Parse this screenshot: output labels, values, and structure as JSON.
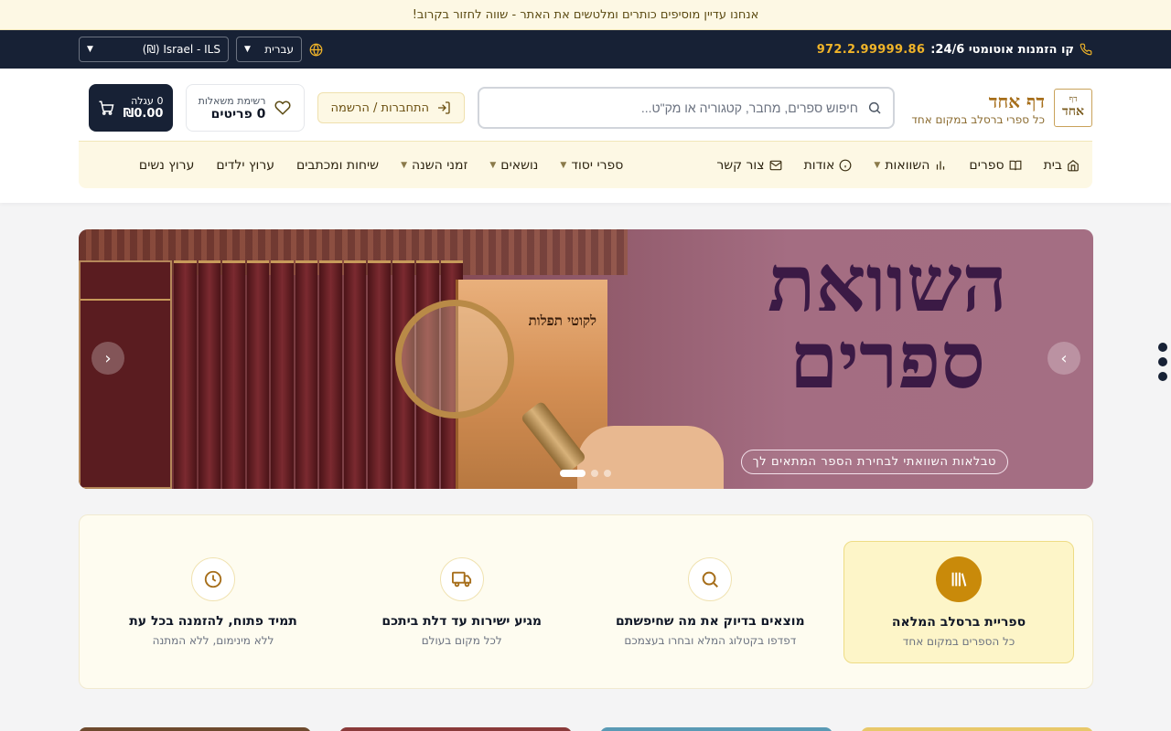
{
  "announcement": "אנחנו עדיין מוסיפים כותרים ומלטשים את האתר - שווה לחזור בקרוב!",
  "topbar": {
    "hotline_label": "קו הזמנות אוטומטי 24/6:",
    "hotline_number": "972.2.99999.86",
    "language": "עברית",
    "currency": "Israel - ILS (₪)"
  },
  "logo": {
    "mark_top": "דף",
    "mark_main": "אחד",
    "name": "דף אחד",
    "tagline": "כל ספרי ברסלב במקום אחד"
  },
  "search": {
    "placeholder": "חיפוש ספרים, מחבר, קטגוריה או מק\"ט..."
  },
  "account": {
    "login_label": "התחברות / הרשמה"
  },
  "wishlist": {
    "label": "רשימת משאלות",
    "count": "0 פריטים"
  },
  "cart": {
    "label": "0 עגלה",
    "amount": "₪0.00"
  },
  "nav": {
    "home": "בית",
    "books": "ספרים",
    "comparisons": "השוואות",
    "about": "אודות",
    "contact": "צור קשר",
    "core_books": "ספרי יסוד",
    "topics": "נושאים",
    "seasons": "זמני השנה",
    "talks": "שיחות ומכתבים",
    "kids": "ערוץ ילדים",
    "women": "ערוץ נשים"
  },
  "hero": {
    "title_line1": "השוואת",
    "title_line2": "ספרים",
    "pill": "טבלאות השוואתי לבחירת הספר המתאים לך",
    "book_title": "לקוטי תפלות",
    "active_slide": 3,
    "total_slides": 3
  },
  "features": [
    {
      "title": "ספריית ברסלב המלאה",
      "subtitle": "כל הספרים במקום אחד",
      "icon": "library-icon"
    },
    {
      "title": "מוצאים בדיוק את מה שחיפשתם",
      "subtitle": "דפדפו בקטלוג המלא ובחרו בעצמכם",
      "icon": "search-icon"
    },
    {
      "title": "מגיע ישירות עד דלת ביתכם",
      "subtitle": "לכל מקום בעולם",
      "icon": "truck-icon"
    },
    {
      "title": "תמיד פתוח, להזמנה בכל עת",
      "subtitle": "ללא מינימום, ללא המתנה",
      "icon": "clock-icon"
    }
  ],
  "colors": {
    "navy": "#172135",
    "gold": "#c98a0a",
    "cream": "#fdf8e4"
  }
}
